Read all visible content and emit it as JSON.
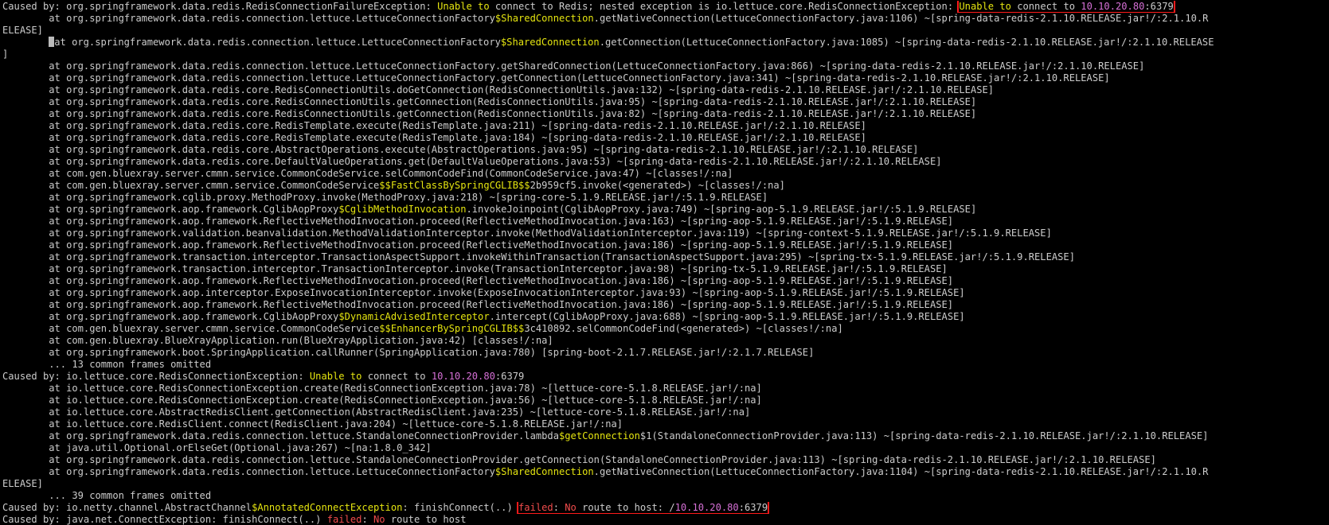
{
  "terminal": {
    "lines": [
      [
        {
          "t": "Caused by: org.springframework.data.redis.RedisConnectionFailureException: ",
          "c": "default"
        },
        {
          "t": "Unable to",
          "c": "yellow"
        },
        {
          "t": " connect to Redis; nested exception is io.lettuce.core.RedisConnectionException: ",
          "c": "default"
        },
        {
          "t": "Unable to",
          "c": "yellow",
          "box": "start"
        },
        {
          "t": " connect to ",
          "c": "default",
          "box": "mid"
        },
        {
          "t": "10.10.20.80",
          "c": "magenta",
          "box": "mid"
        },
        {
          "t": ":6379",
          "c": "default",
          "box": "end"
        }
      ],
      [
        {
          "t": "        at org.springframework.data.redis.connection.lettuce.LettuceConnectionFactory",
          "c": "default"
        },
        {
          "t": "$SharedConnection",
          "c": "yellow"
        },
        {
          "t": ".getNativeConnection(LettuceConnectionFactory.java:1106) ~[spring-data-redis-2.1.10.RELEASE.jar!/:2.1.10.R",
          "c": "default"
        }
      ],
      [
        {
          "t": "ELEASE]",
          "c": "default"
        }
      ],
      [
        {
          "t": "        ",
          "c": "default"
        },
        {
          "t": "",
          "c": "cursor"
        },
        {
          "t": "at org.springframework.data.redis.connection.lettuce.LettuceConnectionFactory",
          "c": "default"
        },
        {
          "t": "$SharedConnection",
          "c": "yellow"
        },
        {
          "t": ".getConnection(LettuceConnectionFactory.java:1085) ~[spring-data-redis-2.1.10.RELEASE.jar!/:2.1.10.RELEASE",
          "c": "default"
        }
      ],
      [
        {
          "t": "]",
          "c": "default"
        }
      ],
      [
        {
          "t": "        at org.springframework.data.redis.connection.lettuce.LettuceConnectionFactory.getSharedConnection(LettuceConnectionFactory.java:866) ~[spring-data-redis-2.1.10.RELEASE.jar!/:2.1.10.RELEASE]",
          "c": "default"
        }
      ],
      [
        {
          "t": "        at org.springframework.data.redis.connection.lettuce.LettuceConnectionFactory.getConnection(LettuceConnectionFactory.java:341) ~[spring-data-redis-2.1.10.RELEASE.jar!/:2.1.10.RELEASE]",
          "c": "default"
        }
      ],
      [
        {
          "t": "        at org.springframework.data.redis.core.RedisConnectionUtils.doGetConnection(RedisConnectionUtils.java:132) ~[spring-data-redis-2.1.10.RELEASE.jar!/:2.1.10.RELEASE]",
          "c": "default"
        }
      ],
      [
        {
          "t": "        at org.springframework.data.redis.core.RedisConnectionUtils.getConnection(RedisConnectionUtils.java:95) ~[spring-data-redis-2.1.10.RELEASE.jar!/:2.1.10.RELEASE]",
          "c": "default"
        }
      ],
      [
        {
          "t": "        at org.springframework.data.redis.core.RedisConnectionUtils.getConnection(RedisConnectionUtils.java:82) ~[spring-data-redis-2.1.10.RELEASE.jar!/:2.1.10.RELEASE]",
          "c": "default"
        }
      ],
      [
        {
          "t": "        at org.springframework.data.redis.core.RedisTemplate.execute(RedisTemplate.java:211) ~[spring-data-redis-2.1.10.RELEASE.jar!/:2.1.10.RELEASE]",
          "c": "default"
        }
      ],
      [
        {
          "t": "        at org.springframework.data.redis.core.RedisTemplate.execute(RedisTemplate.java:184) ~[spring-data-redis-2.1.10.RELEASE.jar!/:2.1.10.RELEASE]",
          "c": "default"
        }
      ],
      [
        {
          "t": "        at org.springframework.data.redis.core.AbstractOperations.execute(AbstractOperations.java:95) ~[spring-data-redis-2.1.10.RELEASE.jar!/:2.1.10.RELEASE]",
          "c": "default"
        }
      ],
      [
        {
          "t": "        at org.springframework.data.redis.core.DefaultValueOperations.get(DefaultValueOperations.java:53) ~[spring-data-redis-2.1.10.RELEASE.jar!/:2.1.10.RELEASE]",
          "c": "default"
        }
      ],
      [
        {
          "t": "        at com.gen.bluexray.server.cmmn.service.CommonCodeService.selCommonCodeFind(CommonCodeService.java:47) ~[classes!/:na]",
          "c": "default"
        }
      ],
      [
        {
          "t": "        at com.gen.bluexray.server.cmmn.service.CommonCodeService",
          "c": "default"
        },
        {
          "t": "$$FastClassBySpringCGLIB$$",
          "c": "yellow"
        },
        {
          "t": "2b959cf5.invoke(<generated>) ~[classes!/:na]",
          "c": "default"
        }
      ],
      [
        {
          "t": "        at org.springframework.cglib.proxy.MethodProxy.invoke(MethodProxy.java:218) ~[spring-core-5.1.9.RELEASE.jar!/:5.1.9.RELEASE]",
          "c": "default"
        }
      ],
      [
        {
          "t": "        at org.springframework.aop.framework.CglibAopProxy",
          "c": "default"
        },
        {
          "t": "$CglibMethodInvocation",
          "c": "yellow"
        },
        {
          "t": ".invokeJoinpoint(CglibAopProxy.java:749) ~[spring-aop-5.1.9.RELEASE.jar!/:5.1.9.RELEASE]",
          "c": "default"
        }
      ],
      [
        {
          "t": "        at org.springframework.aop.framework.ReflectiveMethodInvocation.proceed(ReflectiveMethodInvocation.java:163) ~[spring-aop-5.1.9.RELEASE.jar!/:5.1.9.RELEASE]",
          "c": "default"
        }
      ],
      [
        {
          "t": "        at org.springframework.validation.beanvalidation.MethodValidationInterceptor.invoke(MethodValidationInterceptor.java:119) ~[spring-context-5.1.9.RELEASE.jar!/:5.1.9.RELEASE]",
          "c": "default"
        }
      ],
      [
        {
          "t": "        at org.springframework.aop.framework.ReflectiveMethodInvocation.proceed(ReflectiveMethodInvocation.java:186) ~[spring-aop-5.1.9.RELEASE.jar!/:5.1.9.RELEASE]",
          "c": "default"
        }
      ],
      [
        {
          "t": "        at org.springframework.transaction.interceptor.TransactionAspectSupport.invokeWithinTransaction(TransactionAspectSupport.java:295) ~[spring-tx-5.1.9.RELEASE.jar!/:5.1.9.RELEASE]",
          "c": "default"
        }
      ],
      [
        {
          "t": "        at org.springframework.transaction.interceptor.TransactionInterceptor.invoke(TransactionInterceptor.java:98) ~[spring-tx-5.1.9.RELEASE.jar!/:5.1.9.RELEASE]",
          "c": "default"
        }
      ],
      [
        {
          "t": "        at org.springframework.aop.framework.ReflectiveMethodInvocation.proceed(ReflectiveMethodInvocation.java:186) ~[spring-aop-5.1.9.RELEASE.jar!/:5.1.9.RELEASE]",
          "c": "default"
        }
      ],
      [
        {
          "t": "        at org.springframework.aop.interceptor.ExposeInvocationInterceptor.invoke(ExposeInvocationInterceptor.java:93) ~[spring-aop-5.1.9.RELEASE.jar!/:5.1.9.RELEASE]",
          "c": "default"
        }
      ],
      [
        {
          "t": "        at org.springframework.aop.framework.ReflectiveMethodInvocation.proceed(ReflectiveMethodInvocation.java:186) ~[spring-aop-5.1.9.RELEASE.jar!/:5.1.9.RELEASE]",
          "c": "default"
        }
      ],
      [
        {
          "t": "        at org.springframework.aop.framework.CglibAopProxy",
          "c": "default"
        },
        {
          "t": "$DynamicAdvisedInterceptor",
          "c": "yellow"
        },
        {
          "t": ".intercept(CglibAopProxy.java:688) ~[spring-aop-5.1.9.RELEASE.jar!/:5.1.9.RELEASE]",
          "c": "default"
        }
      ],
      [
        {
          "t": "        at com.gen.bluexray.server.cmmn.service.CommonCodeService",
          "c": "default"
        },
        {
          "t": "$$EnhancerBySpringCGLIB$$",
          "c": "yellow"
        },
        {
          "t": "3c410892.selCommonCodeFind(<generated>) ~[classes!/:na]",
          "c": "default"
        }
      ],
      [
        {
          "t": "        at com.gen.bluexray.BlueXrayApplication.run(BlueXrayApplication.java:42) [classes!/:na]",
          "c": "default"
        }
      ],
      [
        {
          "t": "        at org.springframework.boot.SpringApplication.callRunner(SpringApplication.java:780) [spring-boot-2.1.7.RELEASE.jar!/:2.1.7.RELEASE]",
          "c": "default"
        }
      ],
      [
        {
          "t": "        ... 13 common frames omitted",
          "c": "default"
        }
      ],
      [
        {
          "t": "Caused by: io.lettuce.core.RedisConnectionException: ",
          "c": "default"
        },
        {
          "t": "Unable to",
          "c": "yellow"
        },
        {
          "t": " connect to ",
          "c": "default"
        },
        {
          "t": "10.10.20.80",
          "c": "magenta"
        },
        {
          "t": ":6379",
          "c": "default"
        }
      ],
      [
        {
          "t": "        at io.lettuce.core.RedisConnectionException.create(RedisConnectionException.java:78) ~[lettuce-core-5.1.8.RELEASE.jar!/:na]",
          "c": "default"
        }
      ],
      [
        {
          "t": "        at io.lettuce.core.RedisConnectionException.create(RedisConnectionException.java:56) ~[lettuce-core-5.1.8.RELEASE.jar!/:na]",
          "c": "default"
        }
      ],
      [
        {
          "t": "        at io.lettuce.core.AbstractRedisClient.getConnection(AbstractRedisClient.java:235) ~[lettuce-core-5.1.8.RELEASE.jar!/:na]",
          "c": "default"
        }
      ],
      [
        {
          "t": "        at io.lettuce.core.RedisClient.connect(RedisClient.java:204) ~[lettuce-core-5.1.8.RELEASE.jar!/:na]",
          "c": "default"
        }
      ],
      [
        {
          "t": "        at org.springframework.data.redis.connection.lettuce.StandaloneConnectionProvider.lambda",
          "c": "default"
        },
        {
          "t": "$getConnection",
          "c": "yellow"
        },
        {
          "t": "$1(StandaloneConnectionProvider.java:113) ~[spring-data-redis-2.1.10.RELEASE.jar!/:2.1.10.RELEASE]",
          "c": "default"
        }
      ],
      [
        {
          "t": "        at java.util.Optional.orElseGet(Optional.java:267) ~[na:1.8.0_342]",
          "c": "default"
        }
      ],
      [
        {
          "t": "        at org.springframework.data.redis.connection.lettuce.StandaloneConnectionProvider.getConnection(StandaloneConnectionProvider.java:113) ~[spring-data-redis-2.1.10.RELEASE.jar!/:2.1.10.RELEASE]",
          "c": "default"
        }
      ],
      [
        {
          "t": "        at org.springframework.data.redis.connection.lettuce.LettuceConnectionFactory",
          "c": "default"
        },
        {
          "t": "$SharedConnection",
          "c": "yellow"
        },
        {
          "t": ".getNativeConnection(LettuceConnectionFactory.java:1104) ~[spring-data-redis-2.1.10.RELEASE.jar!/:2.1.10.R",
          "c": "default"
        }
      ],
      [
        {
          "t": "ELEASE]",
          "c": "default"
        }
      ],
      [
        {
          "t": "        ... 39 common frames omitted",
          "c": "default"
        }
      ],
      [
        {
          "t": "Caused by: io.netty.channel.AbstractChannel",
          "c": "default"
        },
        {
          "t": "$AnnotatedConnectException",
          "c": "yellow"
        },
        {
          "t": ": finishConnect(..) ",
          "c": "default"
        },
        {
          "t": "failed",
          "c": "red",
          "box": "start"
        },
        {
          "t": ": ",
          "c": "default",
          "box": "mid"
        },
        {
          "t": "No",
          "c": "red",
          "box": "mid"
        },
        {
          "t": " route to host: /",
          "c": "default",
          "box": "mid"
        },
        {
          "t": "10.10.20.80",
          "c": "magenta",
          "box": "mid"
        },
        {
          "t": ":6379",
          "c": "default",
          "box": "end"
        }
      ],
      [
        {
          "t": "Caused by: java.net.ConnectException: finishConnect(..) ",
          "c": "default"
        },
        {
          "t": "failed",
          "c": "red"
        },
        {
          "t": ": ",
          "c": "default"
        },
        {
          "t": "No",
          "c": "red"
        },
        {
          "t": " route to host",
          "c": "default"
        }
      ]
    ],
    "colors": {
      "background": "#000000",
      "default": "#cccccc",
      "yellow": "#e5e510",
      "magenta": "#d670d6",
      "red": "#f14c4c",
      "highlight_box": "#ff1a1a"
    }
  }
}
